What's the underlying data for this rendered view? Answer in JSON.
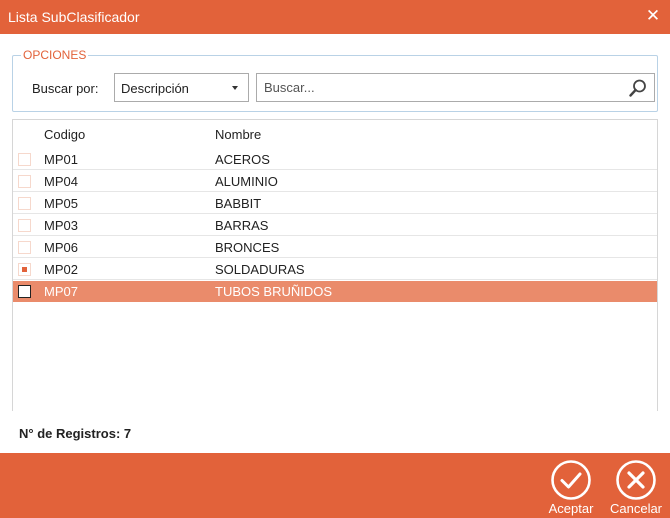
{
  "window": {
    "title": "Lista SubClasificador",
    "close_glyph": "✕"
  },
  "options": {
    "legend": "OPCIONES",
    "search_by_label": "Buscar por:",
    "search_by_value": "Descripción",
    "search_placeholder": "Buscar...",
    "search_value": ""
  },
  "grid": {
    "columns": [
      "Codigo",
      "Nombre"
    ],
    "rows": [
      {
        "code": "MP01",
        "name": "ACEROS",
        "checked": false,
        "selected": false
      },
      {
        "code": "MP04",
        "name": "ALUMINIO",
        "checked": false,
        "selected": false
      },
      {
        "code": "MP05",
        "name": "BABBIT",
        "checked": false,
        "selected": false
      },
      {
        "code": "MP03",
        "name": "BARRAS",
        "checked": false,
        "selected": false
      },
      {
        "code": "MP06",
        "name": "BRONCES",
        "checked": false,
        "selected": false
      },
      {
        "code": "MP02",
        "name": "SOLDADURAS",
        "checked": true,
        "selected": false
      },
      {
        "code": "MP07",
        "name": "TUBOS BRUÑIDOS",
        "checked": false,
        "selected": true
      }
    ]
  },
  "records": {
    "label": "N° de Registros: 7"
  },
  "footer": {
    "accept_label": "Aceptar",
    "cancel_label": "Cancelar"
  },
  "colors": {
    "accent": "#e2623a",
    "selected_row": "#ea8b6b"
  }
}
